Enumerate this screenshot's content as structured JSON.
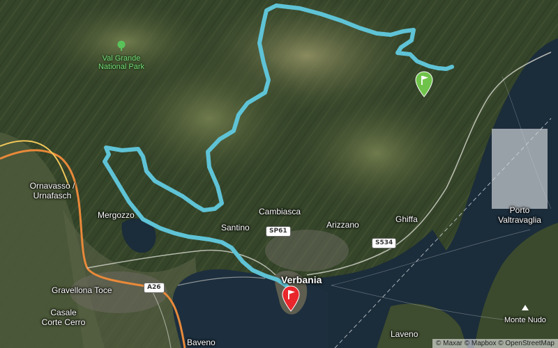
{
  "map": {
    "labels": {
      "val_grande": "Val Grande\nNational Park",
      "ornavasso": "Ornavasso /\nUrnafasch",
      "mergozzo": "Mergozzo",
      "santino": "Santino",
      "cambiasca": "Cambiasca",
      "arizzano": "Arizzano",
      "ghiffa": "Ghiffa",
      "porto_valtravaglia": "Porto\nValtravaglia",
      "verbania": "Verbania",
      "gravellona_toce": "Gravellona Toce",
      "casale_corte_cerro": "Casale\nCorte Cerro",
      "baveno": "Baveno",
      "laveno": "Laveno",
      "monte_nudo": "Monte Nudo"
    },
    "road_shields": {
      "sp61": "SP61",
      "s534": "S534",
      "a26": "A26"
    },
    "attribution": {
      "maxar": "© Maxar",
      "mapbox": "© Mapbox",
      "osm": "© OpenStreetMap"
    },
    "colors": {
      "route": "#5fc3d6",
      "start_marker": "#6fc34a",
      "end_marker": "#e8262b",
      "lake": "#1b2c3a",
      "highway": "#e8893a",
      "regional_road": "#f0c75a"
    },
    "icons": {
      "park": "tree-icon",
      "peak": "mountain-peak-icon",
      "start": "start-flag-marker-icon",
      "end": "finish-flag-marker-icon"
    }
  }
}
